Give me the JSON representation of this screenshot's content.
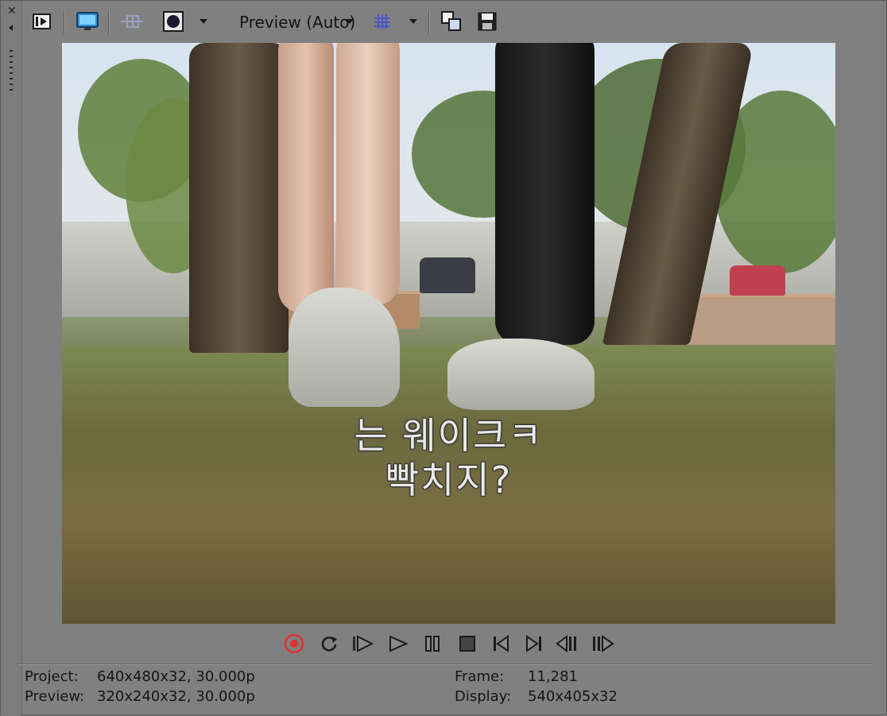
{
  "toolbar": {
    "quality_label": "Preview (Auto)"
  },
  "subtitle": {
    "line1": "는 웨이크ㅋ",
    "line2": "빡치지?"
  },
  "status": {
    "project_label": "Project:",
    "project_value": "640x480x32, 30.000p",
    "preview_label": "Preview:",
    "preview_value": "320x240x32, 30.000p",
    "frame_label": "Frame:",
    "frame_value": "11,281",
    "display_label": "Display:",
    "display_value": "540x405x32"
  },
  "colors": {
    "record_red": "#e03030",
    "grid_blue": "#3b4fd8",
    "panel_gray": "#808080"
  }
}
